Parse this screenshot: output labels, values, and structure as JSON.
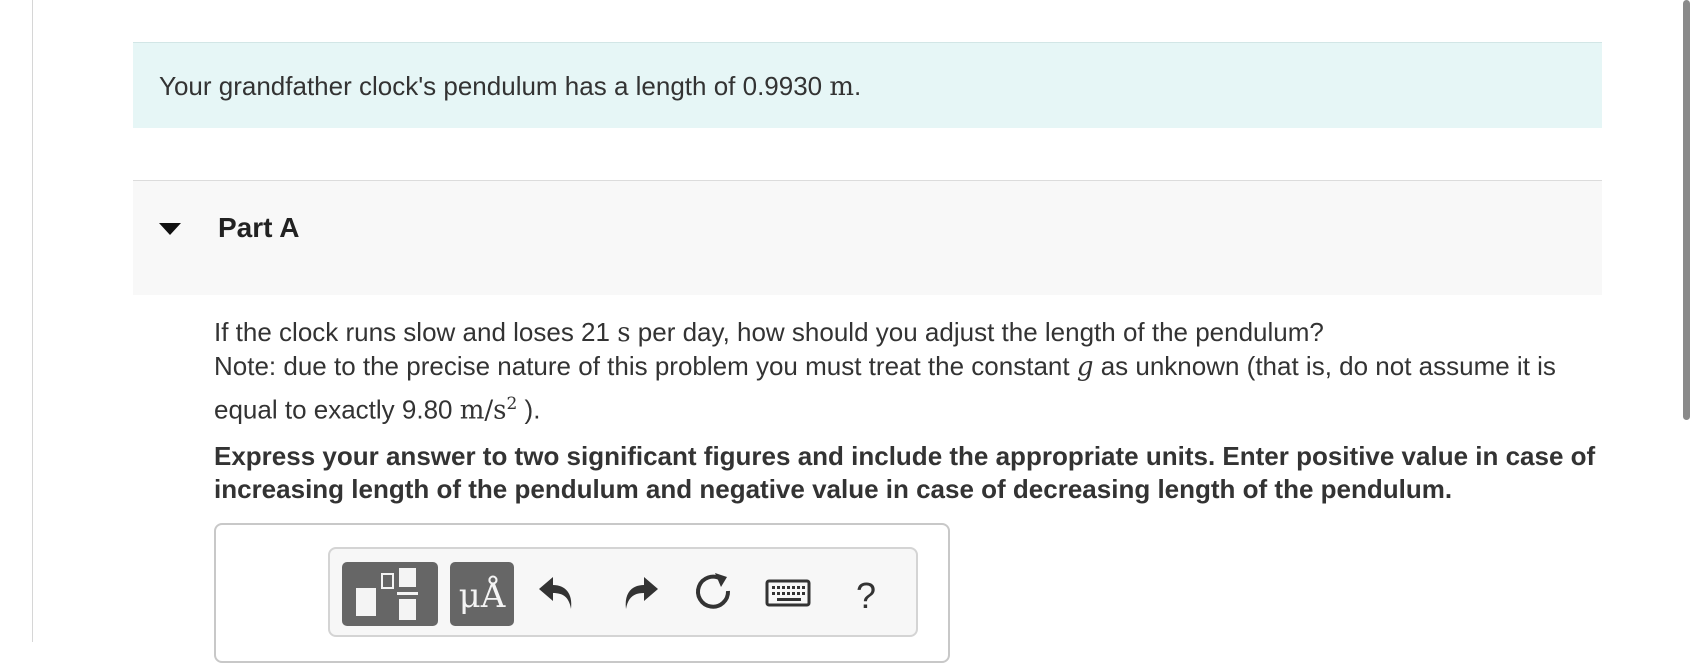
{
  "intro": {
    "text_before": "Your grandfather clock's pendulum has a length of 0.9930 ",
    "unit": "m",
    "text_after": "."
  },
  "part": {
    "title": "Part A",
    "toggle_icon": "caret-down-icon"
  },
  "question": {
    "line1_before": "If the clock runs slow and loses 21 ",
    "line1_unit": "s",
    "line1_after": " per day, how should you adjust the length of the pendulum?",
    "line2_before": "Note: due to the precise nature of this problem you must treat the constant ",
    "line2_var": "g",
    "line2_after": " as unknown (that is, do not assume it is",
    "line3_before": "equal to exactly 9.80 ",
    "line3_unit": "m/s",
    "line3_exp": "2",
    "line3_after": " )."
  },
  "instructions": "Express your answer to two significant figures and include the appropriate units. Enter positive value in case of increasing length of the pendulum and negative value in case of decreasing length of the pendulum.",
  "toolbar": {
    "units_label": "μÅ",
    "help_label": "?",
    "icons": [
      "templates-icon",
      "units-icon",
      "undo-icon",
      "redo-icon",
      "reset-icon",
      "keyboard-icon",
      "help-icon"
    ],
    "button_color": "#666666"
  },
  "colors": {
    "intro_bg": "#e6f6f6",
    "part_bg": "#f8f8f8"
  }
}
